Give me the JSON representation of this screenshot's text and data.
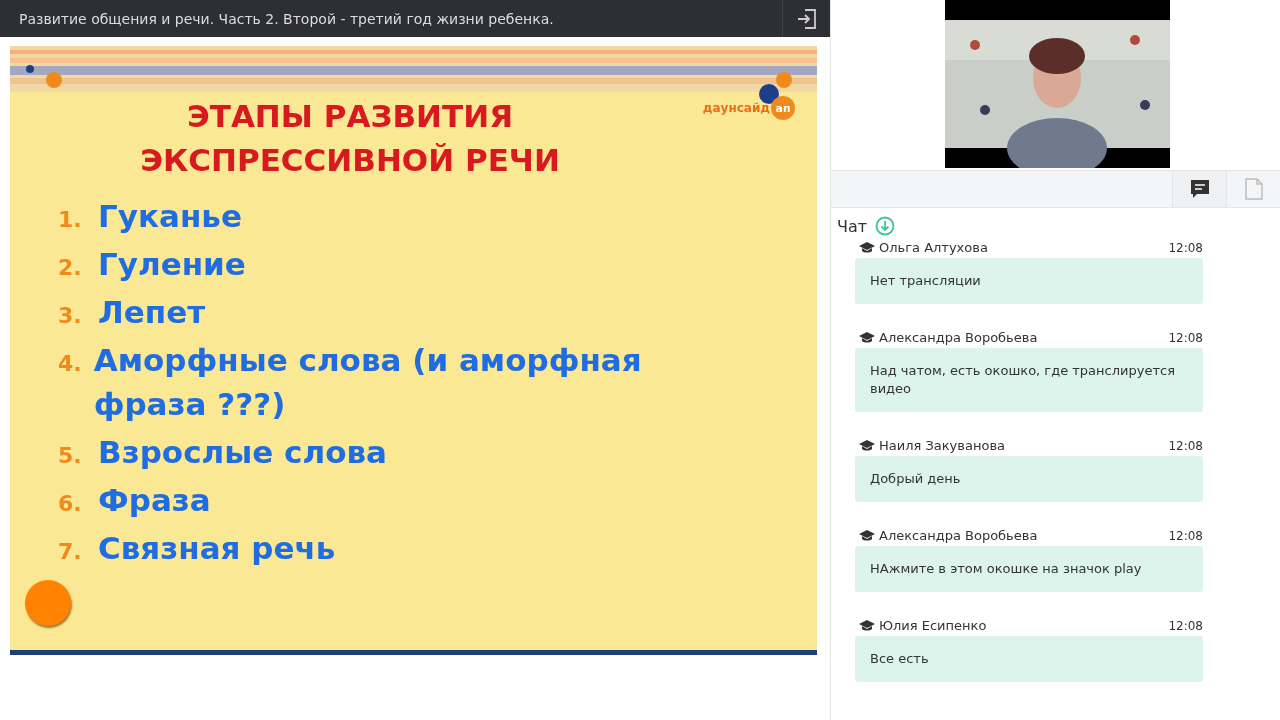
{
  "header": {
    "title": "Развитие общения и речи. Часть 2. Второй - третий год жизни ребенка."
  },
  "slide": {
    "title_lines": [
      "ЭТАПЫ РАЗВИТИЯ",
      "ЭКСПРЕССИВНОЙ РЕЧИ"
    ],
    "logo": {
      "text": "даунсайд",
      "badge": "ап"
    },
    "items": [
      {
        "number": "1.",
        "text": "Гуканье"
      },
      {
        "number": "2.",
        "text": "Гуление"
      },
      {
        "number": "3.",
        "text": "Лепет"
      },
      {
        "number": "4.",
        "text": "Аморфные слова (и аморфная фраза ???)"
      },
      {
        "number": "5.",
        "text": "Взрослые слова"
      },
      {
        "number": "6.",
        "text": "Фраза"
      },
      {
        "number": "7.",
        "text": "Связная речь"
      }
    ]
  },
  "tabs": [
    {
      "kind": "chat",
      "selected": true
    },
    {
      "kind": "document",
      "selected": false
    }
  ],
  "chat": {
    "title": "Чат",
    "messages": [
      {
        "author": "Ольга Алтухова",
        "time": "12:08",
        "text": "Нет трансляции"
      },
      {
        "author": "Александра Воробьева",
        "time": "12:08",
        "text": "Над чатом, есть окошко, где транслируется видео"
      },
      {
        "author": "Наиля Закуванова",
        "time": "12:08",
        "text": "Добрый день"
      },
      {
        "author": "Александра Воробьева",
        "time": "12:08",
        "text": "НАжмите в этом окошке на значок play"
      },
      {
        "author": "Юлия Есипенко",
        "time": "12:08",
        "text": "Все есть"
      }
    ]
  }
}
